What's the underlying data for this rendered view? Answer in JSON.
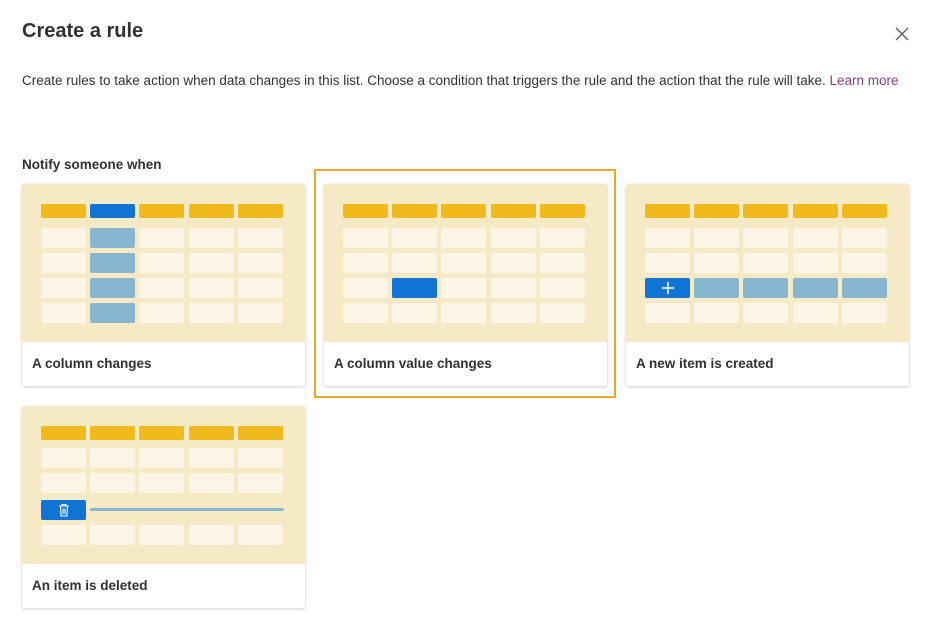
{
  "dialog": {
    "title": "Create a rule",
    "description": "Create rules to take action when data changes in this list. Choose a condition that triggers the rule and the action that the rule will take.",
    "learn_more": "Learn more",
    "section_title": "Notify someone when"
  },
  "cards": [
    {
      "label": "A column changes",
      "selected": false
    },
    {
      "label": "A column value changes",
      "selected": true
    },
    {
      "label": "A new item is created",
      "selected": false
    },
    {
      "label": "An item is deleted",
      "selected": false
    }
  ],
  "colors": {
    "header_cells": "#f0ba1c",
    "thumbnail_bg": "#f6e9c6",
    "cell_bg": "#fdf6e7",
    "accent_blue": "#0f74d4",
    "highlight_blue": "#89b6cf",
    "selection_border": "#e8a92a",
    "link": "#8a3f7a"
  },
  "icons": {
    "close": "close-icon",
    "add": "plus-icon",
    "delete": "trash-icon"
  }
}
